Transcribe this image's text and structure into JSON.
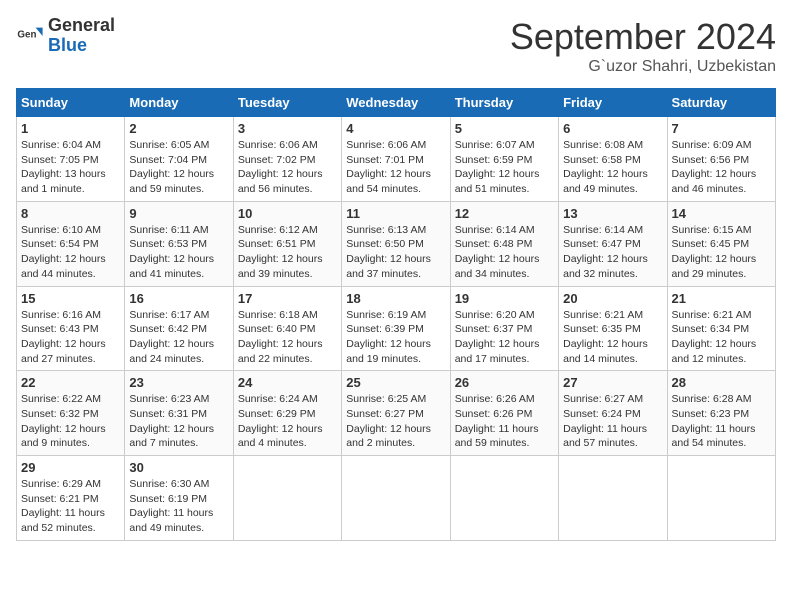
{
  "header": {
    "logo": {
      "text_general": "General",
      "text_blue": "Blue"
    },
    "title": "September 2024",
    "location": "G`uzor Shahri, Uzbekistan"
  },
  "calendar": {
    "days_of_week": [
      "Sunday",
      "Monday",
      "Tuesday",
      "Wednesday",
      "Thursday",
      "Friday",
      "Saturday"
    ],
    "weeks": [
      [
        {
          "day": "1",
          "info": "Sunrise: 6:04 AM\nSunset: 7:05 PM\nDaylight: 13 hours\nand 1 minute."
        },
        {
          "day": "2",
          "info": "Sunrise: 6:05 AM\nSunset: 7:04 PM\nDaylight: 12 hours\nand 59 minutes."
        },
        {
          "day": "3",
          "info": "Sunrise: 6:06 AM\nSunset: 7:02 PM\nDaylight: 12 hours\nand 56 minutes."
        },
        {
          "day": "4",
          "info": "Sunrise: 6:06 AM\nSunset: 7:01 PM\nDaylight: 12 hours\nand 54 minutes."
        },
        {
          "day": "5",
          "info": "Sunrise: 6:07 AM\nSunset: 6:59 PM\nDaylight: 12 hours\nand 51 minutes."
        },
        {
          "day": "6",
          "info": "Sunrise: 6:08 AM\nSunset: 6:58 PM\nDaylight: 12 hours\nand 49 minutes."
        },
        {
          "day": "7",
          "info": "Sunrise: 6:09 AM\nSunset: 6:56 PM\nDaylight: 12 hours\nand 46 minutes."
        }
      ],
      [
        {
          "day": "8",
          "info": "Sunrise: 6:10 AM\nSunset: 6:54 PM\nDaylight: 12 hours\nand 44 minutes."
        },
        {
          "day": "9",
          "info": "Sunrise: 6:11 AM\nSunset: 6:53 PM\nDaylight: 12 hours\nand 41 minutes."
        },
        {
          "day": "10",
          "info": "Sunrise: 6:12 AM\nSunset: 6:51 PM\nDaylight: 12 hours\nand 39 minutes."
        },
        {
          "day": "11",
          "info": "Sunrise: 6:13 AM\nSunset: 6:50 PM\nDaylight: 12 hours\nand 37 minutes."
        },
        {
          "day": "12",
          "info": "Sunrise: 6:14 AM\nSunset: 6:48 PM\nDaylight: 12 hours\nand 34 minutes."
        },
        {
          "day": "13",
          "info": "Sunrise: 6:14 AM\nSunset: 6:47 PM\nDaylight: 12 hours\nand 32 minutes."
        },
        {
          "day": "14",
          "info": "Sunrise: 6:15 AM\nSunset: 6:45 PM\nDaylight: 12 hours\nand 29 minutes."
        }
      ],
      [
        {
          "day": "15",
          "info": "Sunrise: 6:16 AM\nSunset: 6:43 PM\nDaylight: 12 hours\nand 27 minutes."
        },
        {
          "day": "16",
          "info": "Sunrise: 6:17 AM\nSunset: 6:42 PM\nDaylight: 12 hours\nand 24 minutes."
        },
        {
          "day": "17",
          "info": "Sunrise: 6:18 AM\nSunset: 6:40 PM\nDaylight: 12 hours\nand 22 minutes."
        },
        {
          "day": "18",
          "info": "Sunrise: 6:19 AM\nSunset: 6:39 PM\nDaylight: 12 hours\nand 19 minutes."
        },
        {
          "day": "19",
          "info": "Sunrise: 6:20 AM\nSunset: 6:37 PM\nDaylight: 12 hours\nand 17 minutes."
        },
        {
          "day": "20",
          "info": "Sunrise: 6:21 AM\nSunset: 6:35 PM\nDaylight: 12 hours\nand 14 minutes."
        },
        {
          "day": "21",
          "info": "Sunrise: 6:21 AM\nSunset: 6:34 PM\nDaylight: 12 hours\nand 12 minutes."
        }
      ],
      [
        {
          "day": "22",
          "info": "Sunrise: 6:22 AM\nSunset: 6:32 PM\nDaylight: 12 hours\nand 9 minutes."
        },
        {
          "day": "23",
          "info": "Sunrise: 6:23 AM\nSunset: 6:31 PM\nDaylight: 12 hours\nand 7 minutes."
        },
        {
          "day": "24",
          "info": "Sunrise: 6:24 AM\nSunset: 6:29 PM\nDaylight: 12 hours\nand 4 minutes."
        },
        {
          "day": "25",
          "info": "Sunrise: 6:25 AM\nSunset: 6:27 PM\nDaylight: 12 hours\nand 2 minutes."
        },
        {
          "day": "26",
          "info": "Sunrise: 6:26 AM\nSunset: 6:26 PM\nDaylight: 11 hours\nand 59 minutes."
        },
        {
          "day": "27",
          "info": "Sunrise: 6:27 AM\nSunset: 6:24 PM\nDaylight: 11 hours\nand 57 minutes."
        },
        {
          "day": "28",
          "info": "Sunrise: 6:28 AM\nSunset: 6:23 PM\nDaylight: 11 hours\nand 54 minutes."
        }
      ],
      [
        {
          "day": "29",
          "info": "Sunrise: 6:29 AM\nSunset: 6:21 PM\nDaylight: 11 hours\nand 52 minutes."
        },
        {
          "day": "30",
          "info": "Sunrise: 6:30 AM\nSunset: 6:19 PM\nDaylight: 11 hours\nand 49 minutes."
        },
        null,
        null,
        null,
        null,
        null
      ]
    ]
  }
}
